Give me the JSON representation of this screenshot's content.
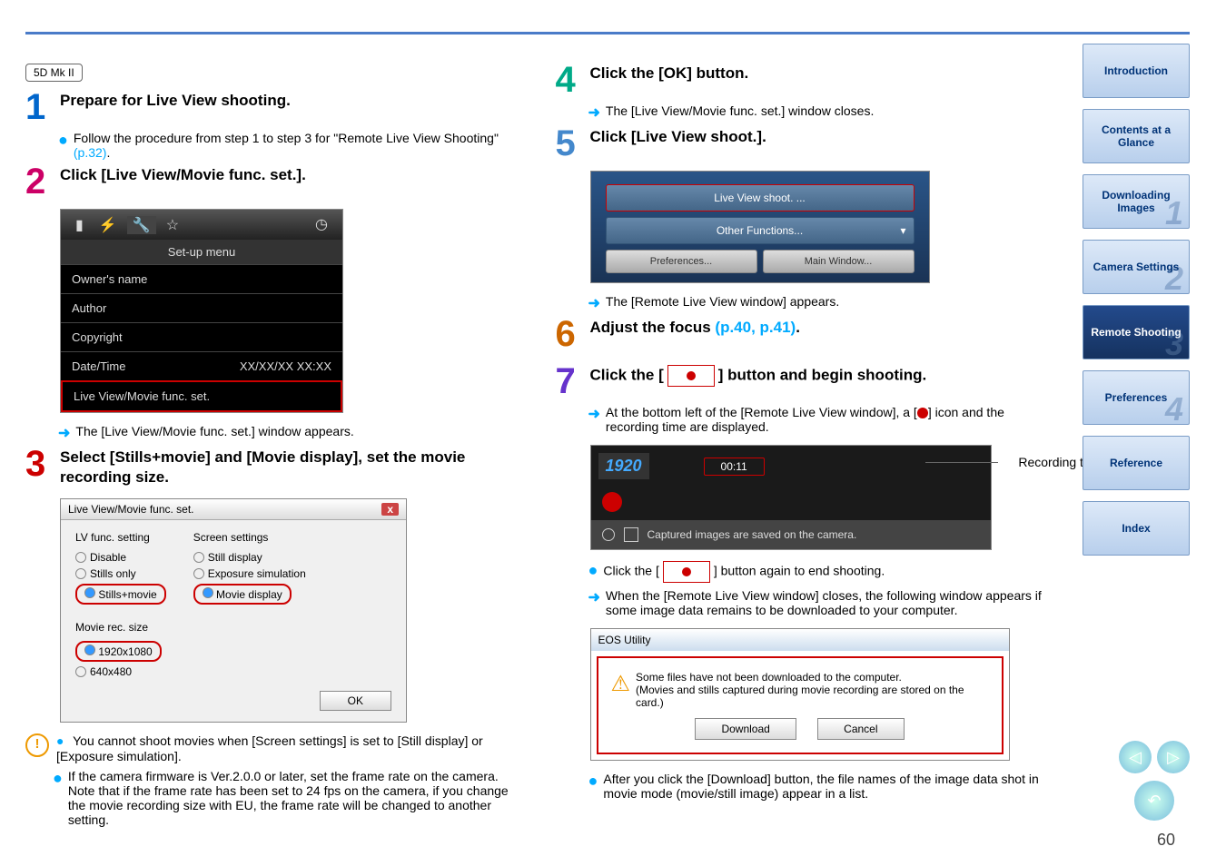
{
  "badge": "5D Mk II",
  "sidebar": {
    "items": [
      "Introduction",
      "Contents at a Glance",
      "Downloading Images",
      "Camera Settings",
      "Remote Shooting",
      "Preferences",
      "Reference",
      "Index"
    ],
    "ghosts": [
      "",
      "",
      "1",
      "2",
      "3",
      "4",
      "",
      ""
    ]
  },
  "page_number": "60",
  "left": {
    "step1": {
      "title": "Prepare for Live View shooting.",
      "bullet": "Follow the procedure from step 1 to step 3 for \"Remote Live View Shooting\" ",
      "link": "(p.32)",
      "tail": "."
    },
    "step2": {
      "title": "Click [Live View/Movie func. set.].",
      "setup_title": "Set-up menu",
      "rows": [
        {
          "l": "Owner's name",
          "r": ""
        },
        {
          "l": "Author",
          "r": ""
        },
        {
          "l": "Copyright",
          "r": ""
        },
        {
          "l": "Date/Time",
          "r": "XX/XX/XX   XX:XX"
        },
        {
          "l": "Live View/Movie func. set.",
          "r": ""
        }
      ],
      "after": "The [Live View/Movie func. set.] window appears."
    },
    "step3": {
      "title": "Select [Stills+movie] and [Movie display], set the movie recording size.",
      "dlg_title": "Live View/Movie func. set.",
      "lv_label": "LV func. setting",
      "lv_opts": [
        "Disable",
        "Stills only",
        "Stills+movie"
      ],
      "screen_label": "Screen settings",
      "screen_opts": [
        "Still display",
        "Exposure simulation",
        "Movie display"
      ],
      "rec_label": "Movie rec. size",
      "rec_opts": [
        "1920x1080",
        "640x480"
      ],
      "ok": "OK"
    },
    "warn1": "You cannot shoot movies when [Screen settings] is set to [Still display] or [Exposure simulation].",
    "warn2": "If the camera firmware is Ver.2.0.0 or later, set the frame rate on the camera. Note that if the frame rate has been set to 24 fps on the camera, if you change the movie recording size with EU, the frame rate will be changed to another setting."
  },
  "right": {
    "step4": {
      "title": "Click the [OK] button.",
      "after": "The [Live View/Movie func. set.] window closes."
    },
    "step5": {
      "title": "Click [Live View shoot.].",
      "btn1": "Live View shoot.  ...",
      "btn2": "Other Functions...",
      "btn3": "Preferences...",
      "btn4": "Main Window...",
      "after": "The [Remote Live View window] appears."
    },
    "step6": {
      "title_a": "Adjust the focus ",
      "link": "(p.40, p.41)",
      "title_b": "."
    },
    "step7": {
      "title_a": "Click the [",
      "title_b": "] button and begin shooting.",
      "bullet_a": "At the bottom left of the [Remote Live View window], a [",
      "bullet_b": "] icon and the recording time are displayed.",
      "res": "1920",
      "timer": "00:11",
      "caption": "Captured images are saved on the camera.",
      "rec_label": "Recording time",
      "click_a": "Click the [",
      "click_b": "] button again to end shooting.",
      "when": "When the [Remote Live View window] closes, the following window appears if some image data remains to be downloaded to your computer.",
      "eos_title": "EOS Utility",
      "eos_msg1": "Some files have not been downloaded to the computer.",
      "eos_msg2": "(Movies and stills captured during movie recording are stored on the card.)",
      "download": "Download",
      "cancel": "Cancel",
      "after": "After you click the [Download] button, the file names of the image data shot in movie mode (movie/still image) appear in a list."
    }
  }
}
